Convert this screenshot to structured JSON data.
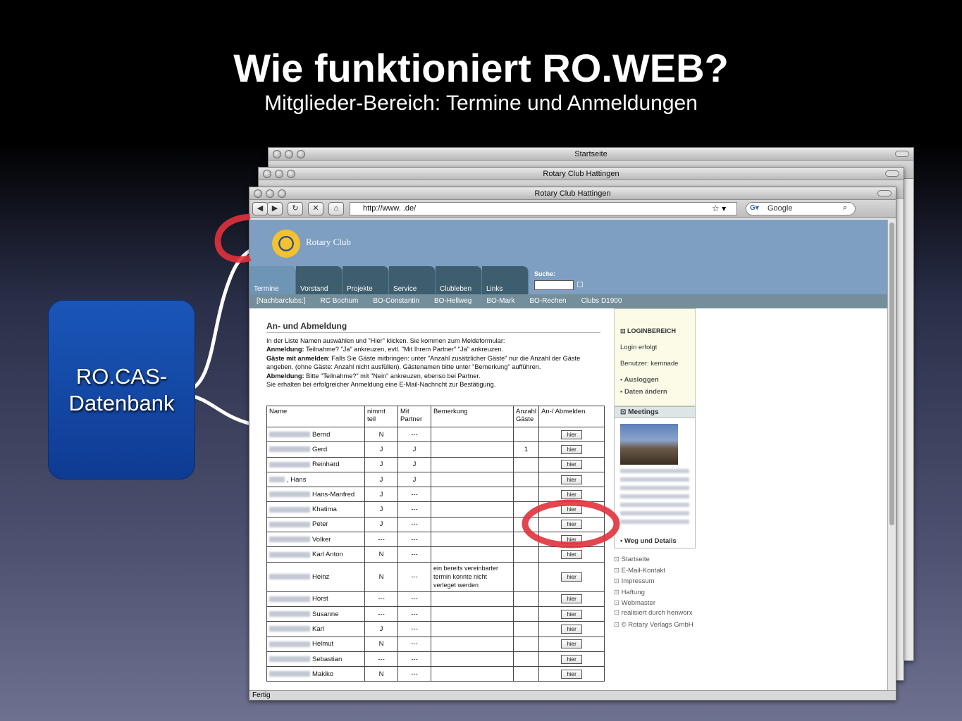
{
  "slide": {
    "title": "Wie funktioniert RO.WEB?",
    "subtitle": "Mitglieder-Bereich: Termine und Anmeldungen",
    "db_label_line1": "RO.CAS-",
    "db_label_line2": "Datenbank"
  },
  "windows": {
    "back": {
      "title": "Startseite"
    },
    "middle": {
      "title": "Rotary Club Hattingen"
    },
    "front": {
      "title": "Rotary Club Hattingen"
    }
  },
  "browser": {
    "url": "http://www.                .de/",
    "search_placeholder": "Google",
    "status": "Fertig"
  },
  "site": {
    "logo_text": "Rotary Club",
    "tabs": [
      "Termine",
      "Vorstand",
      "Projekte",
      "Service",
      "Clubleben",
      "Links"
    ],
    "search_label": "Suche:",
    "subnav": [
      "[Nachbarclubs:]",
      "RC Bochum",
      "BO-Constantin",
      "BO-Hellweg",
      "BO-Mark",
      "BO-Rechen",
      "Clubs D1900"
    ]
  },
  "main": {
    "heading": "An- und Abmeldung",
    "instructions": {
      "line1": "In der Liste Namen auswählen und \"Hier\" klicken. Sie kommen zum Meldeformular:",
      "anm_label": "Anmeldung:",
      "anm_text": " Teilnahme? \"Ja\" ankreuzen, evtl. \"Mit Ihrem Partner\" \"Ja\" ankreuzen.",
      "gaeste_label": "Gäste mit anmelden",
      "gaeste_text": ": Falls Sie Gäste mitbringen: unter \"Anzahl zusätzlicher Gäste\" nur die Anzahl der Gäste angeben. (ohne Gäste: Anzahl nicht ausfüllen). Gästenamen bitte unter \"Bemerkung\" aufführen.",
      "abm_label": "Abmeldung:",
      "abm_text": " Bitte \"Teilnahme?\" mit \"Nein\" ankreuzen, ebenso bei Partner.",
      "line5": "Sie erhalten bei erfolgreicher Anmeldung eine E-Mail-Nachricht zur Bestätigung."
    },
    "table": {
      "headers": [
        "Name",
        "nimmt teil",
        "Mit Partner",
        "Bemerkung",
        "Anzahl Gäste",
        "An-/ Abmelden"
      ],
      "button_label": "hier",
      "rows": [
        {
          "name": "Bernd",
          "teil": "N",
          "partner": "---",
          "bem": "",
          "gaeste": ""
        },
        {
          "name": "Gerd",
          "teil": "J",
          "partner": "J",
          "bem": "",
          "gaeste": "1"
        },
        {
          "name": "Reinhard",
          "teil": "J",
          "partner": "J",
          "bem": "",
          "gaeste": ""
        },
        {
          "name": ", Hans",
          "teil": "J",
          "partner": "J",
          "bem": "",
          "gaeste": ""
        },
        {
          "name": "Hans-Manfred",
          "teil": "J",
          "partner": "---",
          "bem": "",
          "gaeste": ""
        },
        {
          "name": "Khatima",
          "teil": "J",
          "partner": "---",
          "bem": "",
          "gaeste": ""
        },
        {
          "name": "Peter",
          "teil": "J",
          "partner": "---",
          "bem": "",
          "gaeste": ""
        },
        {
          "name": "Volker",
          "teil": "---",
          "partner": "---",
          "bem": "",
          "gaeste": ""
        },
        {
          "name": "Karl Anton",
          "teil": "N",
          "partner": "---",
          "bem": "",
          "gaeste": ""
        },
        {
          "name": "Heinz",
          "teil": "N",
          "partner": "---",
          "bem": "ein bereits vereinbarter termin konnte nicht verleget werden",
          "gaeste": ""
        },
        {
          "name": "Horst",
          "teil": "---",
          "partner": "---",
          "bem": "",
          "gaeste": ""
        },
        {
          "name": "Susanne",
          "teil": "---",
          "partner": "---",
          "bem": "",
          "gaeste": ""
        },
        {
          "name": "Karl",
          "teil": "J",
          "partner": "---",
          "bem": "",
          "gaeste": ""
        },
        {
          "name": "Helmut",
          "teil": "N",
          "partner": "---",
          "bem": "",
          "gaeste": ""
        },
        {
          "name": "Sebastian",
          "teil": "---",
          "partner": "---",
          "bem": "",
          "gaeste": ""
        },
        {
          "name": "Makiko",
          "teil": "N",
          "partner": "---",
          "bem": "",
          "gaeste": ""
        }
      ]
    }
  },
  "sidebar": {
    "login_header": "LOGINBEREICH",
    "login_status": "Login erfolgt",
    "user": "Benutzer: kemnade",
    "logout": "Ausloggen",
    "edit": "Daten ändern",
    "meetings_header": "Meetings",
    "weg": "Weg und Details",
    "links": [
      "Startseite",
      "E-Mail-Kontakt",
      "Impressum",
      "Haftung",
      "Webmaster",
      "realisiert durch henworx"
    ],
    "copyright": "© Rotary Verlags GmbH"
  },
  "colors": {
    "accent_red": "#e0323c",
    "db_blue": "#1a56b8",
    "site_blue": "#7e9fc2"
  },
  "icons": [
    "back-arrow-icon",
    "forward-arrow-icon",
    "reload-icon",
    "stop-icon",
    "home-icon",
    "star-icon",
    "google-icon",
    "magnifier-icon"
  ]
}
